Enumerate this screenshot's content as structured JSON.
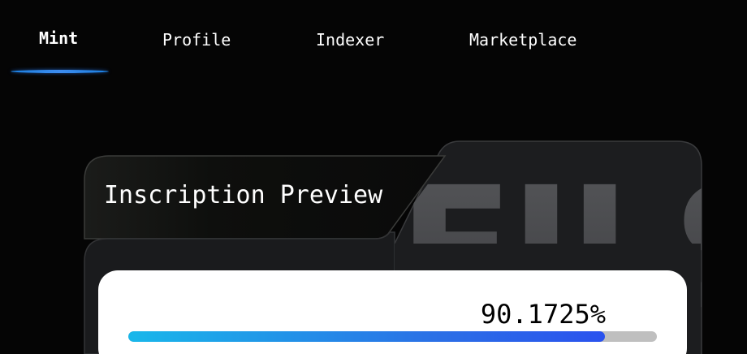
{
  "nav": {
    "tabs": [
      {
        "label": "Mint",
        "active": true
      },
      {
        "label": "Profile",
        "active": false
      },
      {
        "label": "Indexer",
        "active": false
      },
      {
        "label": "Marketplace",
        "active": false
      }
    ],
    "accent_color": "#2f86ee"
  },
  "card": {
    "title": "Inscription Preview",
    "watermark": "FILS",
    "progress": {
      "label": "90.1725%",
      "fraction": 0.901725
    },
    "progress_colors": [
      "#19b7ea",
      "#2a52ee"
    ]
  }
}
